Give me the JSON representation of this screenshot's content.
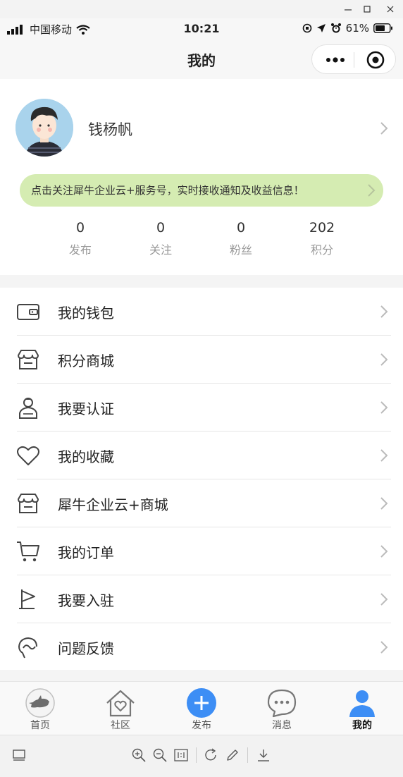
{
  "window": {
    "minimize_icon": "minimize-icon",
    "maximize_icon": "maximize-icon",
    "close_icon": "close-icon"
  },
  "status_bar": {
    "carrier": "中国移动",
    "time": "10:21",
    "battery": "61%"
  },
  "nav": {
    "title": "我的"
  },
  "profile": {
    "name": "钱杨帆",
    "banner_text": "点击关注犀牛企业云+服务号，实时接收通知及收益信息！",
    "stats": [
      {
        "value": "0",
        "label": "发布"
      },
      {
        "value": "0",
        "label": "关注"
      },
      {
        "value": "0",
        "label": "粉丝"
      },
      {
        "value": "202",
        "label": "积分"
      }
    ]
  },
  "menu": [
    {
      "label": "我的钱包",
      "icon": "wallet-icon"
    },
    {
      "label": "积分商城",
      "icon": "store-icon"
    },
    {
      "label": "我要认证",
      "icon": "user-verify-icon"
    },
    {
      "label": "我的收藏",
      "icon": "heart-icon"
    },
    {
      "label": "犀牛企业云+商城",
      "icon": "store-icon"
    },
    {
      "label": "我的订单",
      "icon": "cart-icon"
    },
    {
      "label": "我要入驻",
      "icon": "flag-icon"
    },
    {
      "label": "问题反馈",
      "icon": "feedback-icon"
    }
  ],
  "tabs": [
    {
      "label": "首页",
      "icon": "rhino-logo-icon"
    },
    {
      "label": "社区",
      "icon": "house-heart-icon"
    },
    {
      "label": "发布",
      "icon": "plus-circle-icon"
    },
    {
      "label": "消息",
      "icon": "chat-bubble-icon"
    },
    {
      "label": "我的",
      "icon": "person-icon",
      "active": true
    }
  ],
  "colors": {
    "accent_blue": "#3d8ef5",
    "banner_green": "#d5ecb2",
    "active_tab": "#3d8ef5"
  }
}
